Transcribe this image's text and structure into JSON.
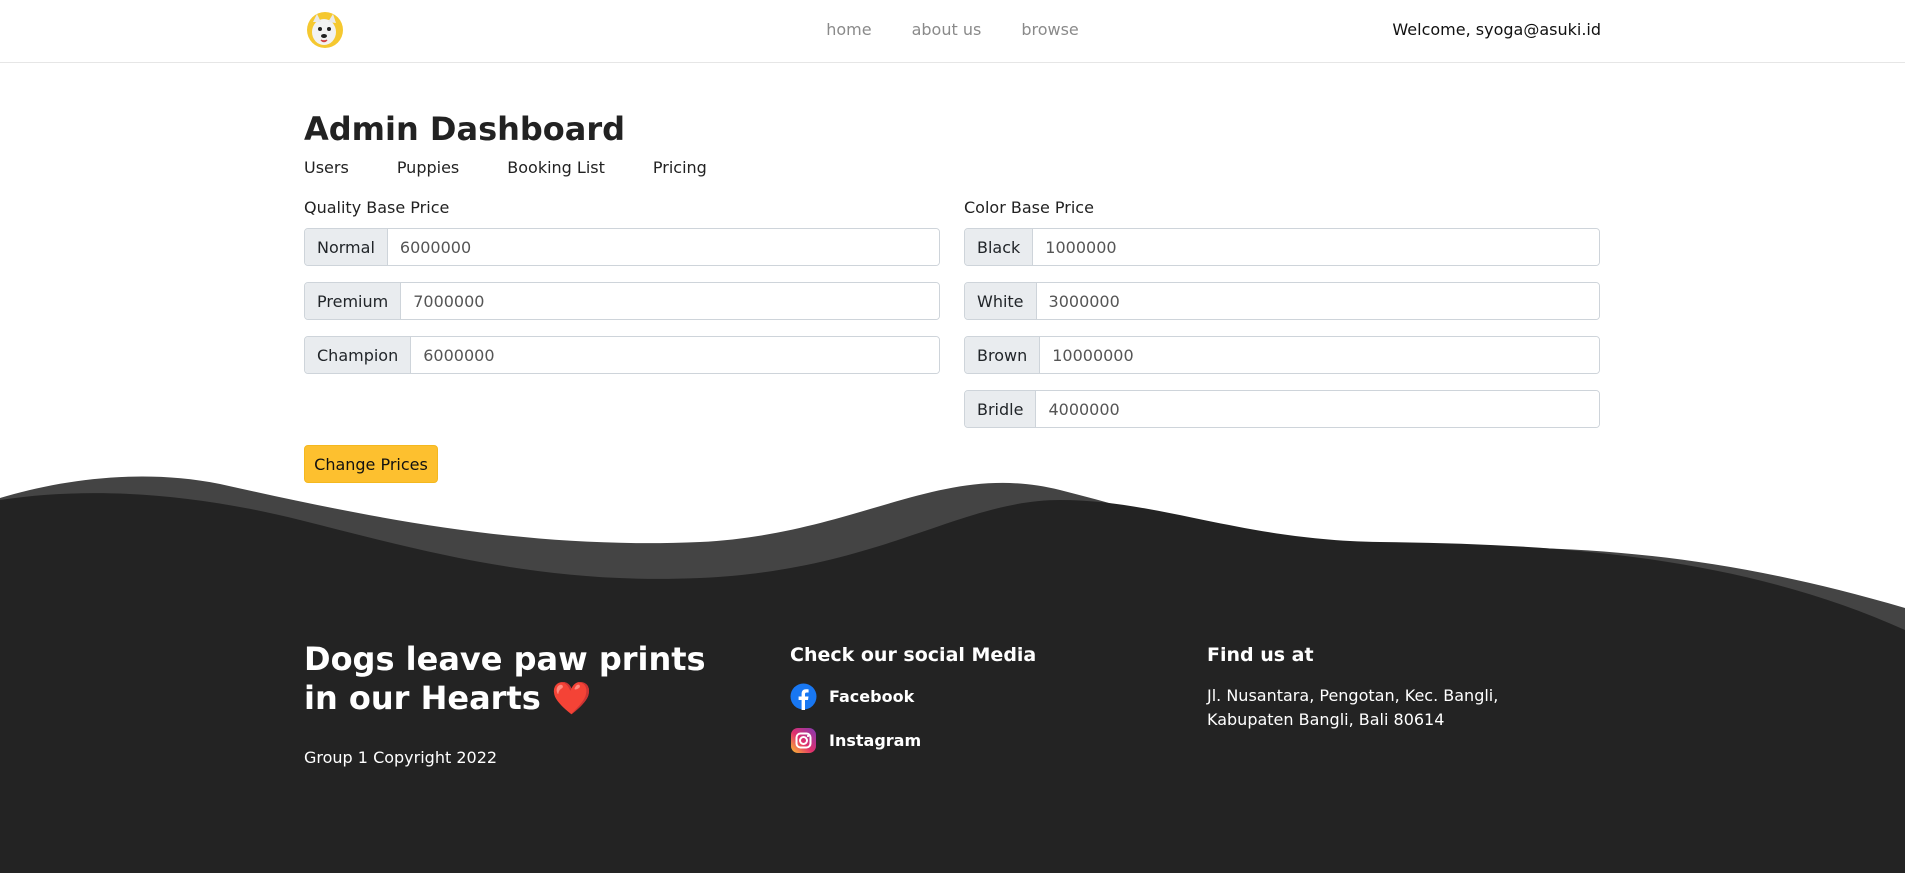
{
  "nav": {
    "links": [
      "home",
      "about us",
      "browse"
    ],
    "welcome": "Welcome, syoga@asuki.id"
  },
  "dashboard": {
    "title": "Admin Dashboard",
    "tabs": [
      "Users",
      "Puppies",
      "Booking List",
      "Pricing"
    ],
    "quality": {
      "title": "Quality Base Price",
      "items": [
        {
          "label": "Normal",
          "value": "6000000"
        },
        {
          "label": "Premium",
          "value": "7000000"
        },
        {
          "label": "Champion",
          "value": "6000000"
        }
      ]
    },
    "color": {
      "title": "Color Base Price",
      "items": [
        {
          "label": "Black",
          "value": "1000000"
        },
        {
          "label": "White",
          "value": "3000000"
        },
        {
          "label": "Brown",
          "value": "10000000"
        },
        {
          "label": "Bridle",
          "value": "4000000"
        }
      ]
    },
    "submit_label": "Change Prices"
  },
  "footer": {
    "quote_line": "Dogs leave paw prints in our Hearts",
    "heart": "❤️",
    "copyright": "Group 1 Copyright 2022",
    "social_title": "Check our social Media",
    "facebook": "Facebook",
    "instagram": "Instagram",
    "find_title": "Find us at",
    "address": "Jl. Nusantara, Pengotan, Kec. Bangli, Kabupaten Bangli, Bali 80614"
  },
  "colors": {
    "accent": "#fdc02f",
    "footer_dark": "#232323",
    "footer_wave": "#444444"
  }
}
